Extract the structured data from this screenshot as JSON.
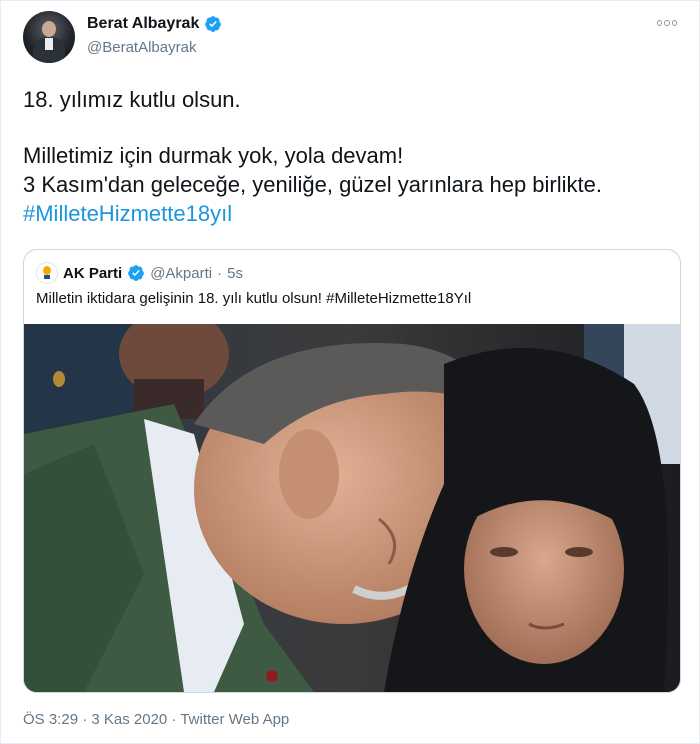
{
  "tweet": {
    "author": {
      "display_name": "Berat Albayrak",
      "handle": "@BeratAlbayrak",
      "verified_icon": "verified-badge-icon"
    },
    "more_icon": "more-options-icon",
    "lines": [
      "18. yılımız kutlu olsun.",
      "Milletimiz için durmak yok, yola devam!",
      "3 Kasım'dan geleceğe, yeniliğe, güzel yarınlara hep birlikte."
    ],
    "hashtag": "#MilleteHizmette18yıl",
    "meta": "ÖS 3:29 · 3 Kas 2020 · Twitter Web App"
  },
  "quoted": {
    "display_name": "AK Parti",
    "handle": "@Akparti",
    "separator": "·",
    "time": "5s",
    "logo_icon": "ak-parti-logo",
    "text_prefix": "Milletin iktidara gelişinin 18. yılı kutlu olsun! ",
    "hashtag": "#MilleteHizmette18Yıl",
    "media": "photo"
  },
  "colors": {
    "link": "#1b95e0",
    "secondary_text": "#657786",
    "verified": "#1da1f2"
  }
}
